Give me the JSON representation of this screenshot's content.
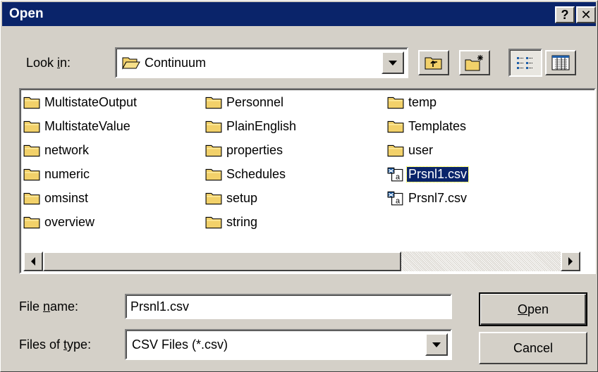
{
  "window": {
    "title": "Open",
    "help_label": "?",
    "close_label": "✕"
  },
  "look_in": {
    "label_prefix": "Look ",
    "label_accel": "i",
    "label_suffix": "n:",
    "value": "Continuum"
  },
  "toolbar": {
    "up_icon": "up-one-level-icon",
    "new_folder_icon": "new-folder-icon",
    "list_icon": "list-view-icon",
    "details_icon": "details-view-icon"
  },
  "files": {
    "col1": [
      {
        "name": "MultistateOutput",
        "type": "folder"
      },
      {
        "name": "MultistateValue",
        "type": "folder"
      },
      {
        "name": "network",
        "type": "folder"
      },
      {
        "name": "numeric",
        "type": "folder"
      },
      {
        "name": "omsinst",
        "type": "folder"
      },
      {
        "name": "overview",
        "type": "folder"
      }
    ],
    "col2": [
      {
        "name": "Personnel",
        "type": "folder"
      },
      {
        "name": "PlainEnglish",
        "type": "folder"
      },
      {
        "name": "properties",
        "type": "folder"
      },
      {
        "name": "Schedules",
        "type": "folder"
      },
      {
        "name": "setup",
        "type": "folder"
      },
      {
        "name": "string",
        "type": "folder"
      }
    ],
    "col3": [
      {
        "name": "temp",
        "type": "folder"
      },
      {
        "name": "Templates",
        "type": "folder"
      },
      {
        "name": "user",
        "type": "folder"
      },
      {
        "name": "Prsnl1.csv",
        "type": "csv",
        "selected": true
      },
      {
        "name": "Prsnl7.csv",
        "type": "csv"
      }
    ]
  },
  "file_name": {
    "label_prefix": "File ",
    "label_accel": "n",
    "label_suffix": "ame:",
    "value": "Prsnl1.csv"
  },
  "file_type": {
    "label_prefix": "Files of ",
    "label_accel": "t",
    "label_suffix": "ype:",
    "value": "CSV Files (*.csv)"
  },
  "buttons": {
    "open_accel": "O",
    "open_rest": "pen",
    "cancel": "Cancel"
  },
  "colors": {
    "title_bar": "#0a246a",
    "face": "#d4d0c8",
    "selection": "#0a246a",
    "folder": "#f2d16a"
  }
}
